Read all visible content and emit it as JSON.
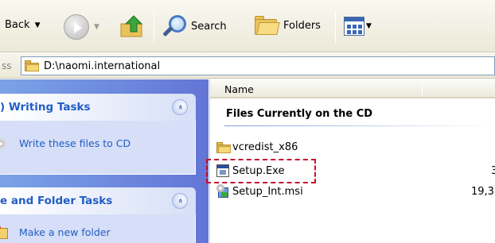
{
  "toolbar": {
    "back_label": "Back",
    "search_label": "Search",
    "folders_label": "Folders",
    "dropdown_glyph": "▼"
  },
  "address": {
    "label_fragment": "ss",
    "path": "D:\\naomi.international"
  },
  "tasks": {
    "writing": {
      "title": ") Writing Tasks",
      "collapse_glyph": "«",
      "items": [
        {
          "label": "Write these files to CD",
          "icon": "cd-icon"
        }
      ]
    },
    "file_folder": {
      "title": "e and Folder Tasks",
      "collapse_glyph": "«",
      "items": [
        {
          "label": "Make a new folder",
          "icon": "new-folder-icon"
        }
      ]
    }
  },
  "file_list": {
    "columns": [
      {
        "label": "Name"
      }
    ],
    "group_title": "Files Currently on the CD",
    "files": [
      {
        "name": "vcredist_x86",
        "type": "folder",
        "size": ""
      },
      {
        "name": "Setup.Exe",
        "type": "exe",
        "size": "3"
      },
      {
        "name": "Setup_Int.msi",
        "type": "msi",
        "size": "19,3"
      }
    ],
    "highlighted": "Setup.Exe"
  },
  "colors": {
    "task_title": "#215dc6",
    "task_pane": "#6f8fe0",
    "highlight_border": "#c8102e"
  }
}
